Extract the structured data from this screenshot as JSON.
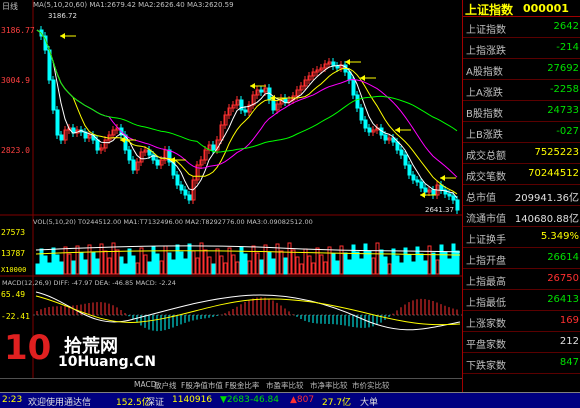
{
  "header": {
    "period_label": "日线",
    "ma_line": "MA(5,10,20,60)  MA1:2679.42  MA2:2626.40  MA3:2620.59",
    "price_high": "3186.72",
    "price_low": "2641.37"
  },
  "y_axis": {
    "main": [
      "3186.77",
      "3004.9",
      "2823.0"
    ],
    "vol": [
      "27573",
      "13787",
      "X10000"
    ],
    "macd": [
      "65.49",
      "-22.41"
    ]
  },
  "vol_label": "VOL(5,10,20)  T0244512.00  MA1:T7132496.00  MA2:T8292776.00  MA3:0.09082512.00",
  "macd_label": "MACD(12,26,9)  DIFF: -47.97  DEA: -46.85  MACD: -2.24",
  "watermark": {
    "logo_num": "10",
    "brand": "拾荒网",
    "domain": "10Huang.CN"
  },
  "tabs": [
    "MACD",
    "散户线",
    "F股净值市值",
    "F股金比率",
    "市盈率比较",
    "市净率比较",
    "市价实比较"
  ],
  "right_panel": {
    "title": "上证指数",
    "code": "000001",
    "rows": [
      {
        "label": "上证指数",
        "value": "2642",
        "color": "green"
      },
      {
        "label": "上指涨跌",
        "value": "-214",
        "color": "green"
      },
      {
        "label": "A股指数",
        "value": "27692",
        "color": "green"
      },
      {
        "label": "上A涨跌",
        "value": "-2258",
        "color": "green"
      },
      {
        "label": "B股指数",
        "value": "24733",
        "color": "green"
      },
      {
        "label": "上B涨跌",
        "value": "-027",
        "color": "green"
      },
      {
        "label": "成交总额",
        "value": "7525223",
        "color": "yellow"
      },
      {
        "label": "成交笔数",
        "value": "70244512",
        "color": "yellow"
      },
      {
        "label": "总市值",
        "value": "209941.36亿",
        "color": "white"
      },
      {
        "label": "流通市值",
        "value": "140680.88亿",
        "color": "white"
      },
      {
        "label": "上证换手",
        "value": "5.349%",
        "color": "yellow"
      },
      {
        "label": "上指开盘",
        "value": "26614",
        "color": "green"
      },
      {
        "label": "上指最高",
        "value": "26750",
        "color": "red"
      },
      {
        "label": "上指最低",
        "value": "26413",
        "color": "green"
      },
      {
        "label": "上涨家数",
        "value": "169",
        "color": "red"
      },
      {
        "label": "平盘家数",
        "value": "212",
        "color": "white"
      },
      {
        "label": "下跌家数",
        "value": "847",
        "color": "green"
      }
    ]
  },
  "statusbar": {
    "items": [
      {
        "text": "2:23",
        "color": "yellow"
      },
      {
        "text": "欢迎使用通达信",
        "color": "white"
      },
      {
        "text": "152.5亿",
        "color": "yellow"
      },
      {
        "text": "深证",
        "color": "white"
      },
      {
        "text": "1140916",
        "color": "yellow"
      },
      {
        "text": "▼2683",
        "color": "green"
      },
      {
        "text": "-46.84",
        "color": "green"
      },
      {
        "text": "▲807",
        "color": "red"
      },
      {
        "text": "27.7亿",
        "color": "yellow"
      },
      {
        "text": "大单",
        "color": "white"
      }
    ]
  },
  "colors": {
    "up": "#ff3030",
    "down": "#00ffff",
    "ma1": "#ffffff",
    "ma2": "#ffff00",
    "ma3": "#ff00ff",
    "ma4": "#00ff00",
    "arrow": "#ffff00"
  }
}
